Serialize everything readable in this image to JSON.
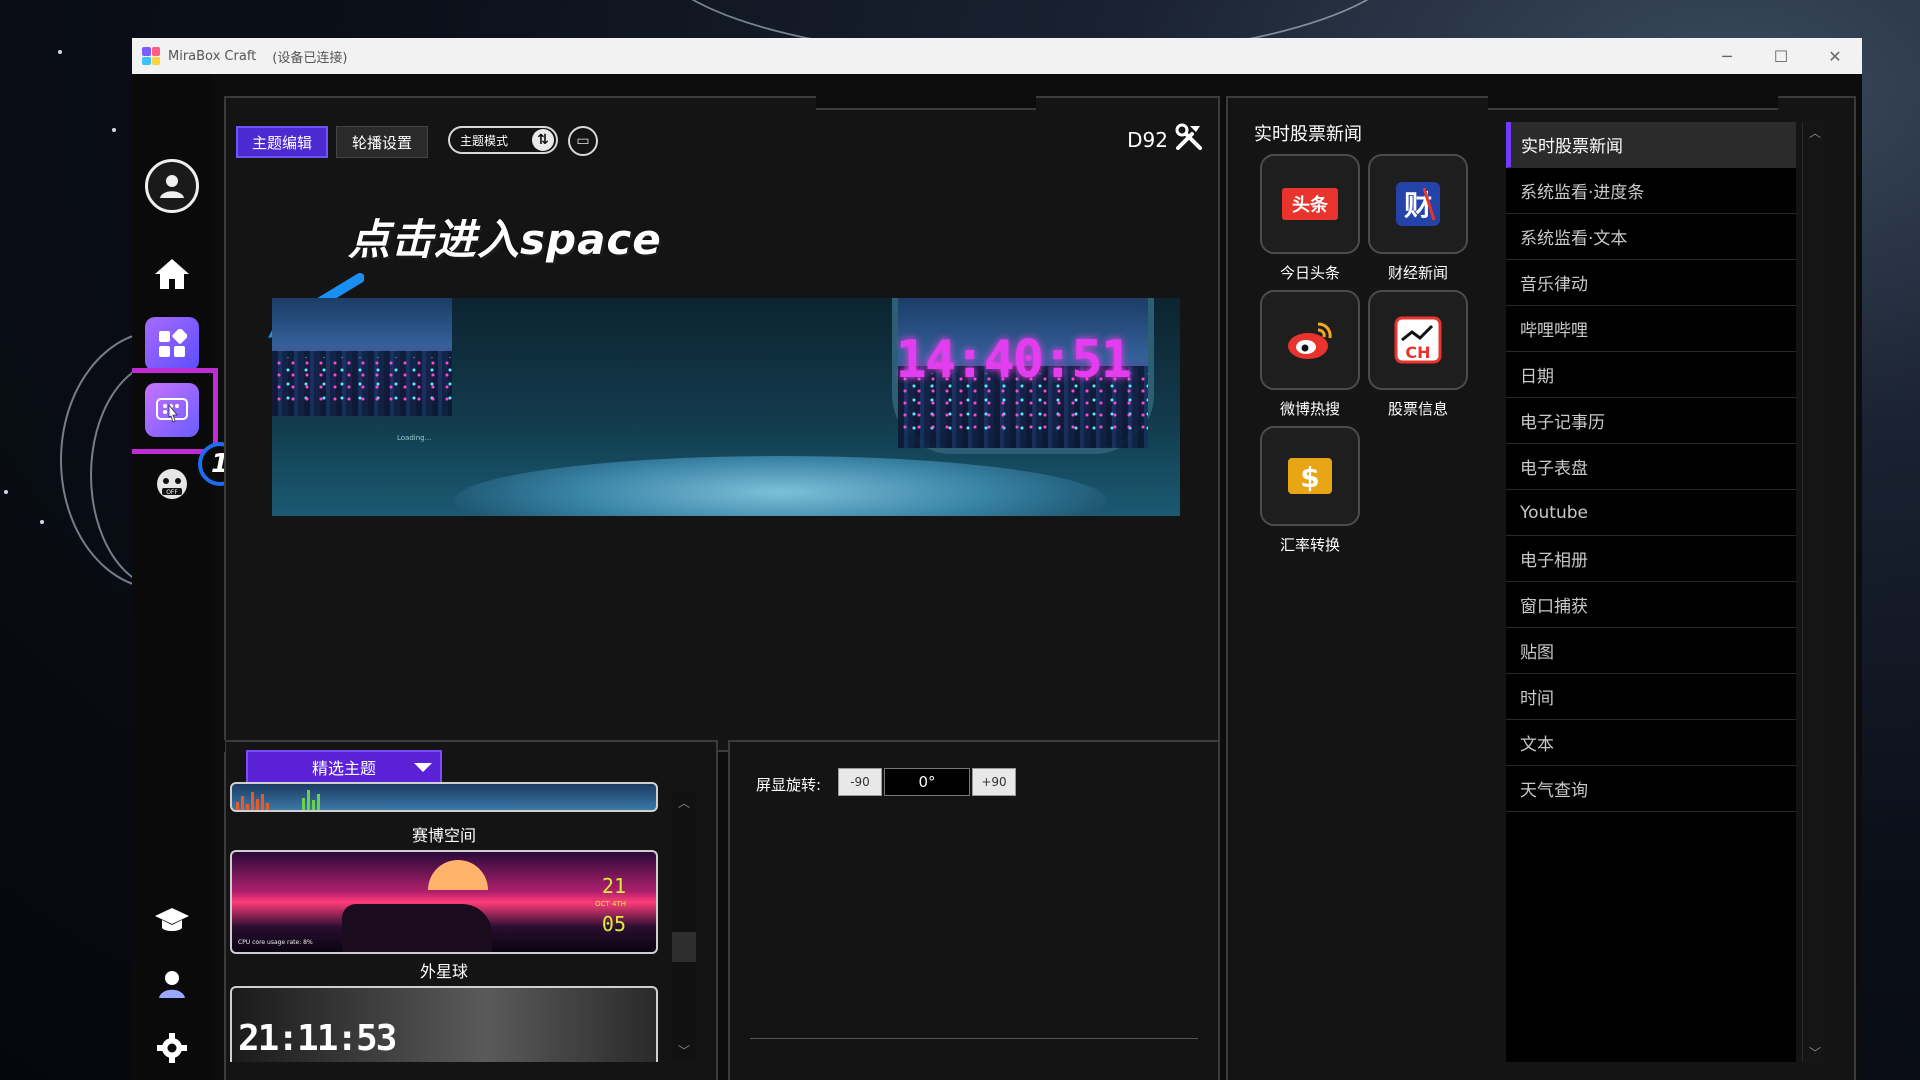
{
  "window": {
    "title": "MiraBox Craft",
    "status": "(设备已连接)",
    "controls": {
      "minimize": "─",
      "maximize": "☐",
      "close": "✕"
    }
  },
  "sidebar": {
    "items": [
      {
        "name": "account",
        "icon": "user-icon"
      },
      {
        "name": "home",
        "icon": "home-icon"
      },
      {
        "name": "apps",
        "icon": "apps-grid-icon"
      },
      {
        "name": "space",
        "icon": "space-icon",
        "highlighted": true
      },
      {
        "name": "off-mode",
        "icon": "game-off-icon"
      },
      {
        "name": "tutorial",
        "icon": "graduation-cap-icon"
      },
      {
        "name": "community",
        "icon": "users-icon"
      },
      {
        "name": "settings",
        "icon": "gear-icon"
      }
    ],
    "step_badge": "1"
  },
  "editor": {
    "tabs": [
      "主题编辑",
      "轮播设置"
    ],
    "active_tab": 0,
    "mode_toggle": "主题模式",
    "device": "D92",
    "annotation": "点击进入space",
    "preview": {
      "clock": "14:40:51",
      "loading": "Loading..."
    }
  },
  "themes": {
    "dropdown": "精选主题",
    "items": [
      {
        "label": "赛博空间"
      },
      {
        "label": "外星球",
        "overlay": {
          "clock_top": "21",
          "clock_mid": "OCT 4TH",
          "clock_bottom": "05",
          "cpu": "CPU core usage rate: 8%"
        }
      },
      {
        "label": "",
        "overlay": {
          "clock": "21:11:53"
        }
      }
    ]
  },
  "rotation": {
    "label": "屏显旋转:",
    "left_btn": "-90",
    "value": "0°",
    "right_btn": "+90"
  },
  "news": {
    "title": "实时股票新闻",
    "tiles": [
      {
        "label": "今日头条",
        "icon": "toutiao-icon",
        "text": "头条",
        "color": "#e8342c"
      },
      {
        "label": "财经新闻",
        "icon": "finance-news-icon",
        "text": "财",
        "color": "#2343a8"
      },
      {
        "label": "微博热搜",
        "icon": "weibo-icon",
        "color": "#e8342c"
      },
      {
        "label": "股票信息",
        "icon": "stock-chart-icon",
        "text": "CH",
        "color": "#e8342c"
      },
      {
        "label": "汇率转换",
        "icon": "dollar-icon",
        "text": "$",
        "color": "#e8a617"
      }
    ]
  },
  "plugin_list": {
    "items": [
      "实时股票新闻",
      "系统监看·进度条",
      "系统监看·文本",
      "音乐律动",
      "哔哩哔哩",
      "日期",
      "电子记事历",
      "电子表盘",
      "Youtube",
      "电子相册",
      "窗口捕获",
      "贴图",
      "时间",
      "文本",
      "天气查询"
    ],
    "active": 0
  },
  "colors": {
    "accent": "#5b21d6",
    "highlight": "#c02bd6",
    "badge": "#1b6df2"
  }
}
